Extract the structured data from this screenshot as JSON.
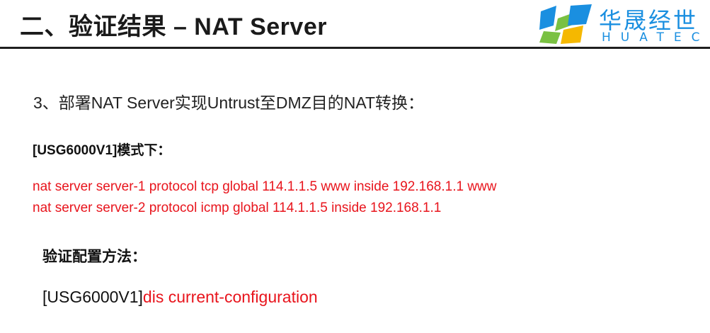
{
  "header": {
    "title": "二、验证结果 – NAT Server",
    "logo": {
      "name_cn": "华晟经世",
      "name_en": "HUATEC",
      "mark_colors": [
        "#1a8fe0",
        "#7ac142",
        "#f5b800"
      ]
    }
  },
  "content": {
    "step_heading": "3、部署NAT Server实现Untrust至DMZ目的NAT转换：",
    "mode_label": "[USG6000V1]模式下：",
    "commands": [
      "nat server server-1 protocol tcp global 114.1.1.5 www inside 192.168.1.1 www",
      "nat server server-2 protocol icmp global 114.1.1.5 inside 192.168.1.1"
    ],
    "verify_label": "验证配置方法：",
    "verify_prompt": "[USG6000V1]",
    "verify_command": "dis current-configuration"
  },
  "colors": {
    "command_red": "#e8141c",
    "logo_blue": "#1a8fe0"
  }
}
